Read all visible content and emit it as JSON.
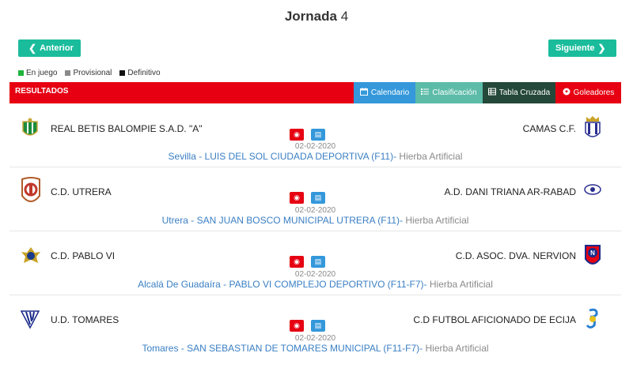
{
  "header": {
    "title_bold": "Jornada",
    "title_num": "4"
  },
  "nav": {
    "prev_label": "Anterior",
    "next_label": "Siguiente"
  },
  "legend": [
    {
      "label": "En juego",
      "color": "#1fb53c"
    },
    {
      "label": "Provisional",
      "color": "#8a8a8a"
    },
    {
      "label": "Definitivo",
      "color": "#111111"
    }
  ],
  "bar": {
    "title": "RESULTADOS",
    "tabs": [
      {
        "label": "Calendario",
        "icon": "calendar-icon"
      },
      {
        "label": "Clasificación",
        "icon": "list-icon"
      },
      {
        "label": "Tabla Cruzada",
        "icon": "table-icon"
      },
      {
        "label": "Goleadores",
        "icon": "soccer-ball-icon"
      }
    ]
  },
  "matches": [
    {
      "home": "REAL BETIS BALOMPIE S.A.D. \"A\"",
      "away": "CAMAS C.F.",
      "date": "02-02-2020",
      "venue": "Sevilla - LUIS DEL SOL CIUDADA DEPORTIVA (F11)-",
      "surface": " Hierba Artificial"
    },
    {
      "home": "C.D. UTRERA",
      "away": "A.D. DANI TRIANA AR-RABAD",
      "date": "02-02-2020",
      "venue": "Utrera - SAN JUAN BOSCO MUNICIPAL UTRERA (F11)-",
      "surface": " Hierba Artificial"
    },
    {
      "home": "C.D. PABLO VI",
      "away": "C.D. ASOC. DVA. NERVION",
      "date": "02-02-2020",
      "venue": "Alcalá De Guadaíra - PABLO VI COMPLEJO DEPORTIVO (F11-F7)-",
      "surface": " Hierba Artificial"
    },
    {
      "home": "U.D. TOMARES",
      "away": "C.D FUTBOL AFICIONADO DE ECIJA",
      "date": "02-02-2020",
      "venue": "Tomares - SAN SEBASTIAN DE TOMARES MUNICIPAL (F11-F7)-",
      "surface": " Hierba Artificial"
    }
  ]
}
